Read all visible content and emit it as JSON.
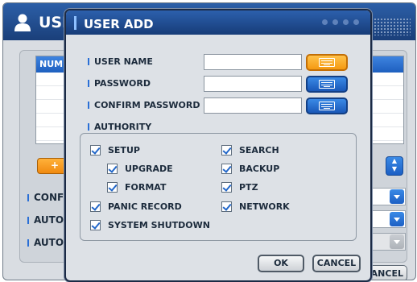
{
  "background": {
    "title": "USI",
    "table_header": "NUM",
    "orange_button": "+",
    "labels": [
      "CONFI",
      "AUTO",
      "AUTO"
    ],
    "cancel_label": "ANCEL"
  },
  "dialog": {
    "title": "USER ADD",
    "fields": {
      "user_name_label": "USER NAME",
      "user_name_value": "",
      "password_label": "PASSWORD",
      "password_value": "",
      "confirm_label": "CONFIRM PASSWORD",
      "confirm_value": ""
    },
    "authority_label": "AUTHORITY",
    "authority": {
      "setup": {
        "label": "SETUP",
        "checked": true
      },
      "upgrade": {
        "label": "UPGRADE",
        "checked": true
      },
      "format": {
        "label": "FORMAT",
        "checked": true
      },
      "panic_record": {
        "label": "PANIC RECORD",
        "checked": true
      },
      "system_shutdown": {
        "label": "SYSTEM SHUTDOWN",
        "checked": true
      },
      "search": {
        "label": "SEARCH",
        "checked": true
      },
      "backup": {
        "label": "BACKUP",
        "checked": true
      },
      "ptz": {
        "label": "PTZ",
        "checked": true
      },
      "network": {
        "label": "NETWORK",
        "checked": true
      }
    },
    "ok_label": "OK",
    "cancel_label": "CANCEL"
  },
  "colors": {
    "title_bar": "#1f4c8f",
    "accent_blue": "#2a6fd6",
    "orange": "#f59a12"
  },
  "icons": [
    "user-icon",
    "keyboard-icon",
    "checkbox-icon",
    "dropdown-arrow-icon"
  ]
}
